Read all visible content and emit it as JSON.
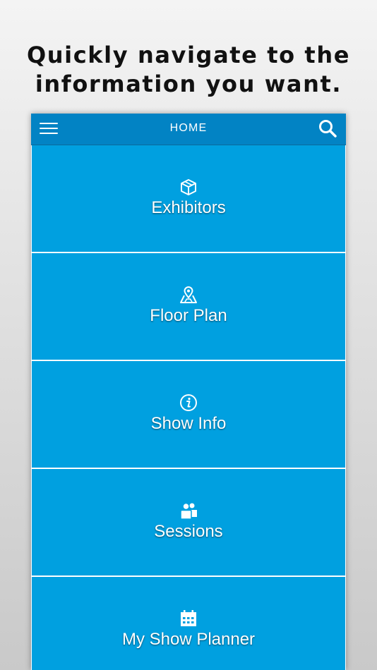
{
  "headline": {
    "line1": "Quickly navigate to the",
    "line2": "information you want."
  },
  "navbar": {
    "title": "HOME",
    "menu_icon": "hamburger-menu-icon",
    "search_icon": "search-icon"
  },
  "tiles": [
    {
      "label": "Exhibitors",
      "icon": "box-icon"
    },
    {
      "label": "Floor Plan",
      "icon": "map-pin-icon"
    },
    {
      "label": "Show Info",
      "icon": "info-icon"
    },
    {
      "label": "Sessions",
      "icon": "people-icon"
    },
    {
      "label": "My Show Planner",
      "icon": "calendar-icon"
    }
  ],
  "colors": {
    "navbar": "#0283c4",
    "tile": "#00a0e0",
    "text_light": "#ffffff",
    "headline": "#111111"
  }
}
